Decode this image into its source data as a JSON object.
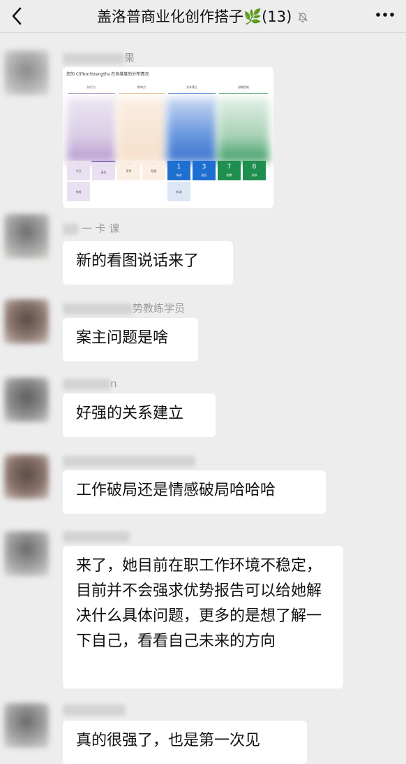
{
  "header": {
    "title": "盖洛普商业化创作搭子",
    "leaf_glyph": "🌿",
    "count": "(13)",
    "back_icon": "back-arrow-icon",
    "mute_icon": "muted-bell-icon",
    "more_icon": "more-dots-icon"
  },
  "image_card": {
    "title": "您的 CliftonStrengths 在各维度的分布情况",
    "domains": [
      {
        "label": "执行力",
        "color": "#a48bc4"
      },
      {
        "label": "影响力",
        "color": "#e8b58a"
      },
      {
        "label": "关系建立",
        "color": "#4a7fd1"
      },
      {
        "label": "战略思维",
        "color": "#4aa06a"
      }
    ],
    "cells": [
      {
        "num": "1",
        "label": "体谅"
      },
      {
        "num": "3",
        "label": "伯乐"
      },
      {
        "num": "7",
        "label": "统筹"
      },
      {
        "num": "8",
        "label": "关联"
      }
    ]
  },
  "messages": [
    {
      "name_suffix": "果"
    },
    {
      "name_suffix": "一 卡 课",
      "text": "新的看图说话来了"
    },
    {
      "name_suffix": "势教练学员",
      "text": "案主问题是啥"
    },
    {
      "name_suffix": "n",
      "text": "好强的关系建立"
    },
    {
      "name_suffix": "",
      "text": "工作破局还是情感破局哈哈哈"
    },
    {
      "name_suffix": "",
      "text": "来了，她目前在职工作环境不稳定，目前并不会强求优势报告可以给她解决什么具体问题，更多的是想了解一下自己，看看自己未来的方向"
    },
    {
      "name_suffix": "",
      "text": "真的很强了，也是第一次见"
    }
  ]
}
